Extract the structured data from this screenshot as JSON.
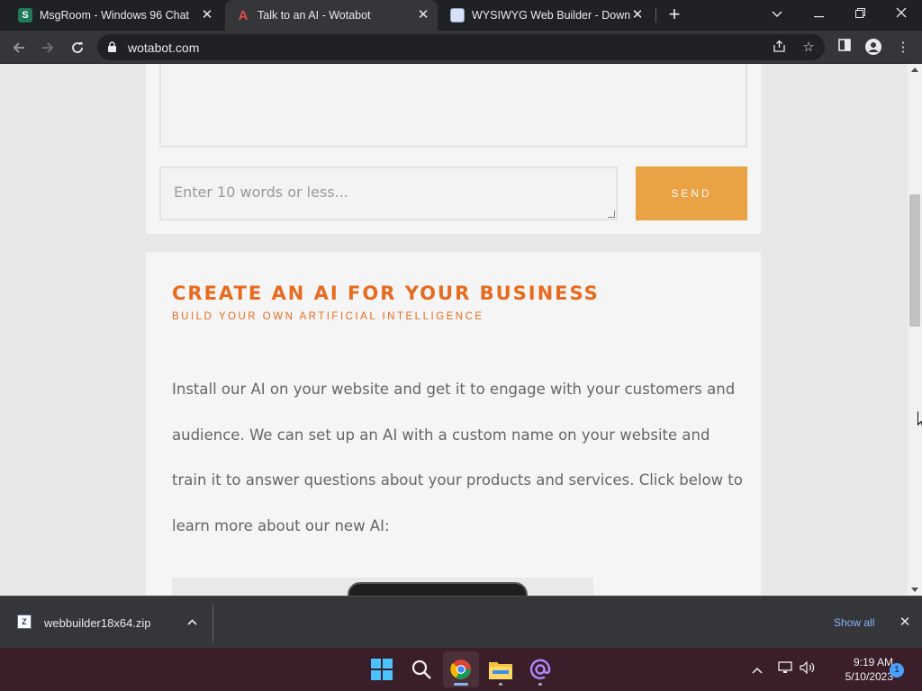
{
  "browser": {
    "tabs": [
      {
        "title": "MsgRoom - Windows 96 Chat",
        "favicon_text": "S",
        "active": false
      },
      {
        "title": "Talk to an AI - Wotabot",
        "favicon_text": "A",
        "active": true
      },
      {
        "title": "WYSIWYG Web Builder - Downlo",
        "favicon_text": "",
        "active": false
      }
    ],
    "new_tab_icon": "plus-icon",
    "url": "wotabot.com"
  },
  "page": {
    "chat": {
      "input_placeholder": "Enter 10 words or less...",
      "send_label": "SEND",
      "accent_color": "#e9a244"
    },
    "business": {
      "title": "CREATE AN AI FOR YOUR BUSINESS",
      "subtitle": "BUILD YOUR OWN ARTIFICIAL INTELLIGENCE",
      "body_lines": [
        "Install our AI on your website and get it to engage with your customers and",
        "audience. We can set up an AI with a custom name on your website and",
        "train it to answer questions about your products and services. Click below to",
        "learn more about our new AI:"
      ],
      "title_color": "#e86a1e"
    }
  },
  "downloads": {
    "file_name": "webbuilder18x64.zip",
    "show_all_label": "Show all"
  },
  "taskbar": {
    "time": "9:19 AM",
    "date": "5/10/2023",
    "notification_count": "1",
    "apps": [
      "start-icon",
      "search-icon",
      "chrome-icon",
      "file-explorer-icon",
      "mail-icon"
    ]
  }
}
